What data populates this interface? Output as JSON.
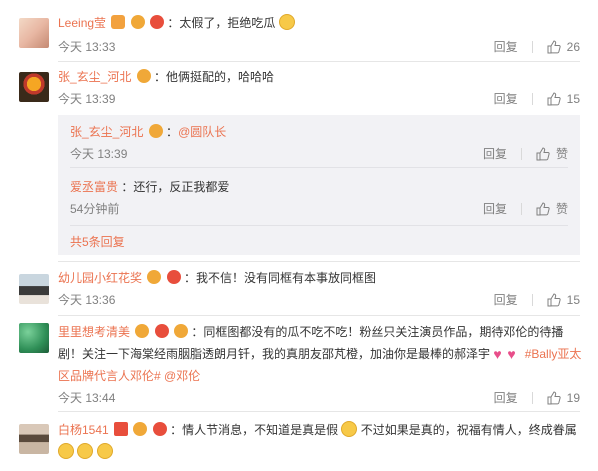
{
  "comments": [
    {
      "user": "Leeing莹",
      "text": "：太假了，拒绝吃瓜",
      "time": "今天 13:33",
      "reply": "回复",
      "likes": "26"
    },
    {
      "user": "张_玄尘_河北",
      "text": "：他俩挺配的，哈哈哈",
      "time": "今天 13:39",
      "reply": "回复",
      "likes": "15",
      "subreplies": [
        {
          "user": "张_玄尘_河北",
          "text_prefix": "：",
          "mention": "@圆队长",
          "time": "今天 13:39",
          "reply": "回复",
          "like": "赞"
        },
        {
          "user": "爱丞富贵",
          "text": "：还行，反正我都爱",
          "time": "54分钟前",
          "reply": "回复",
          "like": "赞"
        }
      ],
      "more": "共5条回复"
    },
    {
      "user": "幼儿园小红花奖",
      "text": "：我不信！没有同框有本事放同框图",
      "time": "今天 13:36",
      "reply": "回复",
      "likes": "15"
    },
    {
      "user": "里里想考清美",
      "text_a": "：同框图都没有的瓜不吃不吃！粉丝只关注演员作品，期待邓伦的待播剧！关注一下海棠经雨胭脂透朗月钎，我的真朋友邵芃橙，加油你是最棒的郝泽宇",
      "topic": "#Bally亚太区品牌代言人邓伦#",
      "mention": "@邓伦",
      "time": "今天 13:44",
      "reply": "回复",
      "likes": "19"
    },
    {
      "user": "白杨1541",
      "text_a": "：情人节消息，不知道是真是假",
      "text_b": "不过如果是真的，祝福有情人，终成眷属"
    }
  ],
  "colors": {
    "accent": "#eb7350",
    "meta": "#808080",
    "subbg": "#f2f2f5"
  }
}
